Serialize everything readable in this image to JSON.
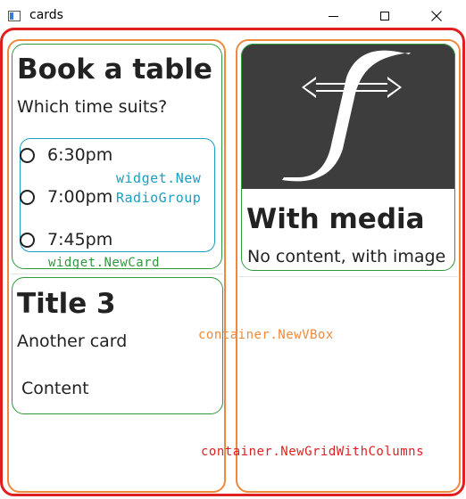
{
  "window": {
    "title": "cards",
    "controls": {
      "minimize": "minimize",
      "maximize": "maximize",
      "close": "close"
    }
  },
  "cards": {
    "book": {
      "title": "Book a table",
      "subtitle": "Which time suits?",
      "radio_options": [
        "6:30pm",
        "7:00pm",
        "7:45pm"
      ]
    },
    "title3": {
      "title": "Title 3",
      "subtitle": "Another card",
      "content": "Content"
    },
    "media": {
      "title": "With media",
      "subtitle": "No content, with image",
      "image_icon": "fyne-logo-icon"
    }
  },
  "annotations": {
    "radiogroup_line1": "widget.New",
    "radiogroup_line2": "RadioGroup",
    "newcard": "widget.NewCard",
    "vbox": "container.NewVBox",
    "grid": "container.NewGridWithColumns"
  },
  "colors": {
    "grid_outline": "#e02020",
    "vbox_outline": "#ee8a3c",
    "card_outline": "#2f9a3b",
    "radiogroup_outline": "#1a9fc2",
    "media_background": "#3d3d3d"
  }
}
